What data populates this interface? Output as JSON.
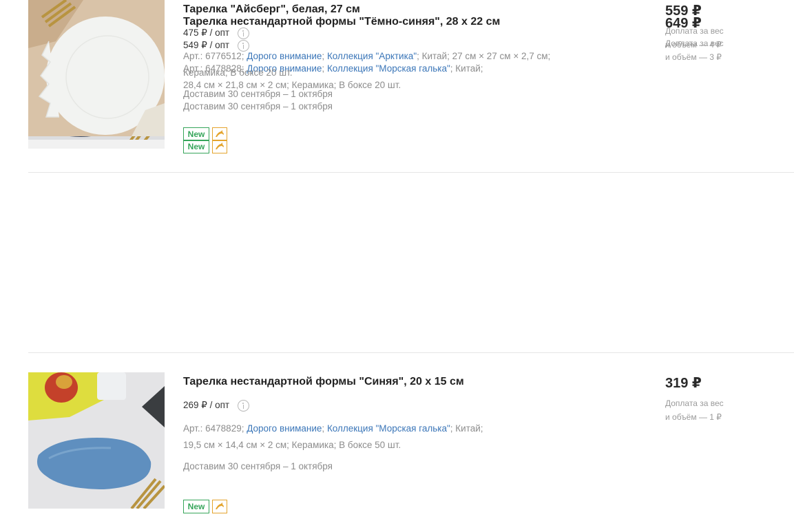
{
  "products": [
    {
      "title": "Тарелка нестандартной формы \"Тёмно-синяя\", 28 х 22 см",
      "opt_price": "549 ₽ / опт",
      "article": "Арт.: 6478828;",
      "tag1": "Дорого внимание",
      "tag1_sep": ";",
      "tag2": "Коллекция \"Морская галька\"",
      "meta_rest": "; Китай;",
      "meta_line2": "28,4 см × 21,8 см × 2 см; Керамика; В боксе 20 шт.",
      "delivery": "Доставим 30 сентября – 1 октября",
      "badge_new": "New",
      "price": "649 ₽",
      "surcharge_line1": "Доплата за вес",
      "surcharge_line2": "и объём — 3 ₽",
      "badge_icon": "dolphin-icon"
    },
    {
      "title": "Тарелка нестандартной формы \"Синяя\", 20 х 15 см",
      "opt_price": "269 ₽ / опт",
      "article": "Арт.: 6478829;",
      "tag1": "Дорого внимание",
      "tag1_sep": ";",
      "tag2": "Коллекция \"Морская галька\"",
      "meta_rest": "; Китай;",
      "meta_line2": "19,5 см × 14,4 см × 2 см; Керамика; В боксе 50 шт.",
      "delivery": "Доставим 30 сентября – 1 октября",
      "badge_new": "New",
      "price": "319 ₽",
      "surcharge_line1": "Доплата за вес",
      "surcharge_line2": "и объём — 1 ₽",
      "badge_icon": "dolphin-icon"
    },
    {
      "title": "Тарелка \"Айсберг\", белая, 27 см",
      "opt_price": "475 ₽ / опт",
      "article": "Арт.: 6776512;",
      "tag1": "Дорого внимание",
      "tag1_sep": ";",
      "tag2": "Коллекция \"Арктика\"",
      "meta_rest": "; Китай; 27 см × 27 см × 2,7 см;",
      "meta_line2": "Керамика; В боксе 20 шт.",
      "delivery": "Доставим 30 сентября – 1 октября",
      "badge_new": "New",
      "price": "559 ₽",
      "surcharge_line1": "Доплата за вес",
      "surcharge_line2": "и объём — 4 ₽",
      "badge_icon": "dolphin-icon"
    }
  ],
  "colors": {
    "link": "#3b76b8",
    "badge_new": "#36a55a",
    "badge_dolphin": "#e4a42d",
    "muted_text": "#8c8c8c"
  }
}
